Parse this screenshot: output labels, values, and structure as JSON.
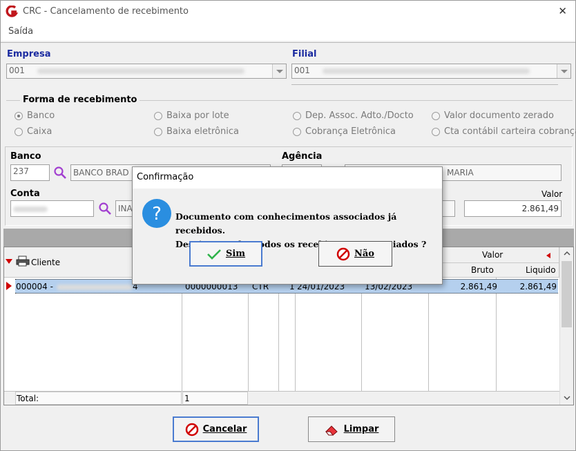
{
  "window": {
    "title": "CRC - Cancelamento de recebimento",
    "close_glyph": "✕",
    "icon": "app-logo-icon"
  },
  "menu": {
    "items": [
      {
        "label": "Saída"
      }
    ]
  },
  "empresa": {
    "label": "Empresa",
    "value": "001"
  },
  "filial": {
    "label": "Filial",
    "value": "001"
  },
  "forma": {
    "label": "Forma de recebimento",
    "options": [
      {
        "label": "Banco",
        "selected": true
      },
      {
        "label": "Baixa por lote",
        "selected": false
      },
      {
        "label": "Dep. Assoc. Adto./Docto",
        "selected": false
      },
      {
        "label": "Valor documento zerado",
        "selected": false
      },
      {
        "label": "Caixa",
        "selected": false
      },
      {
        "label": "Baixa eletrônica",
        "selected": false
      },
      {
        "label": "Cobrança Eletrônica",
        "selected": false
      },
      {
        "label": "Cta contábil carteira cobrança",
        "selected": false
      }
    ]
  },
  "banco": {
    "label": "Banco",
    "code": "237",
    "name": "BANCO BRAD"
  },
  "agencia": {
    "label": "Agência",
    "name": "MARIA"
  },
  "conta": {
    "label": "Conta",
    "name": "INA"
  },
  "valor": {
    "label": "Valor",
    "value": "2.861,49"
  },
  "grid": {
    "col_cliente": "Cliente",
    "col_valor": "Valor",
    "col_bruto": "Bruto",
    "col_liquido": "Liquido",
    "row": {
      "cliente": "000004 -",
      "cliente_suffix": "4",
      "doc": "0000000013",
      "tipo": "CTR",
      "parcela": "1",
      "emissao": "24/01/2023",
      "vencimento": "13/02/2023",
      "bruto": "2.861,49",
      "liquido": "2.861,49"
    },
    "total_label": "Total:",
    "total_count": "1"
  },
  "buttons": {
    "cancelar": "Cancelar",
    "limpar": "Limpar"
  },
  "dialog": {
    "title": "Confirmação",
    "line1": "Documento com conhecimentos associados já recebidos.",
    "line2": "Deseja cancelar todos os recebimentos associados ?",
    "yes": "Sim",
    "no": "Não"
  },
  "colors": {
    "label_blue": "#1a2aa0",
    "selection": "#b5d0ee",
    "marker_red": "#d00000",
    "accent": "#2a7fd4"
  }
}
